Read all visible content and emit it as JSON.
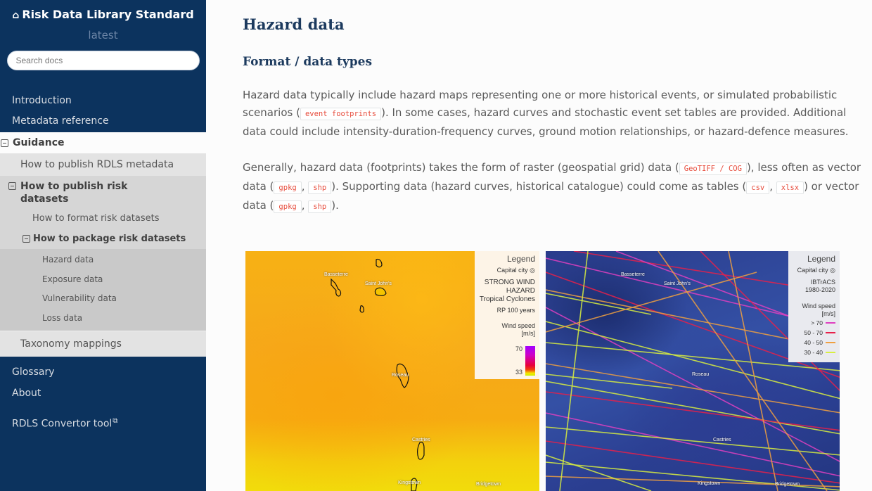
{
  "sidebar": {
    "brand": "Risk Data Library Standard",
    "home_icon": "home-icon",
    "version": "latest",
    "search_placeholder": "Search docs",
    "top_items": [
      "Introduction",
      "Metadata reference"
    ],
    "guidance": {
      "label": "Guidance",
      "children": {
        "publish_metadata": "How to publish RDLS metadata",
        "publish_risk": {
          "label": "How to publish risk datasets",
          "format": "How to format risk datasets",
          "package": {
            "label": "How to package risk datasets",
            "items": [
              "Hazard data",
              "Exposure data",
              "Vulnerability data",
              "Loss data"
            ]
          }
        },
        "taxonomy": "Taxonomy mappings"
      }
    },
    "bottom_items": [
      "Glossary",
      "About"
    ],
    "external": {
      "label": "RDLS Convertor tool",
      "icon": "external-link-icon"
    }
  },
  "main": {
    "title": "Hazard data",
    "subtitle": "Format / data types",
    "para1": {
      "t1": "Hazard data typically include hazard maps representing one or more historical events, or simulated probabilistic scenarios (",
      "c1": "event footprints",
      "t2": "). In some cases, hazard curves and stochastic event set tables are provided. Additional data could include intensity-duration-frequency curves, ground motion relationships, or hazard-defence measures."
    },
    "para2": {
      "t1": "Generally, hazard data (footprints) takes the form of raster (geospatial grid) data (",
      "c1": "GeoTIFF / COG",
      "t2": "), less often as vector data (",
      "c2": "gpkg",
      "t3": ", ",
      "c3": "shp",
      "t4": "). Supporting data (hazard curves, historical catalogue) could come as tables (",
      "c4": "csv",
      "t5": ", ",
      "c5": "xlsx",
      "t6": ") or vector data (",
      "c6": "gpkg",
      "t7": ", ",
      "c7": "shp",
      "t8": ")."
    }
  },
  "maps": {
    "left": {
      "legend_title": "Legend",
      "capital_city": "Capital city",
      "hazard_line1": "STRONG WIND",
      "hazard_line2": "HAZARD",
      "hazard_line3": "Tropical Cyclones",
      "rp": "RP 100 years",
      "var": "Wind speed",
      "unit": "[m/s]",
      "max": "70",
      "min": "33",
      "cities": [
        "Basseterre",
        "Saint John's",
        "Roseau",
        "Castries",
        "Kingstown",
        "Bridgetown"
      ]
    },
    "right": {
      "legend_title": "Legend",
      "capital_city": "Capital city",
      "source": "IBTrACS",
      "period": "1980-2020",
      "var": "Wind speed",
      "unit": "[m/s]",
      "classes": [
        {
          "label": "> 70",
          "color": "#e040c0"
        },
        {
          "label": "50 - 70",
          "color": "#e8204a"
        },
        {
          "label": "40 - 50",
          "color": "#f0a040"
        },
        {
          "label": "30 - 40",
          "color": "#d8ee40"
        }
      ],
      "cities": [
        "Basseterre",
        "Saint John's",
        "Roseau",
        "Castries",
        "Kingstown",
        "Bridgetown"
      ]
    }
  },
  "colors": {
    "sidebar_bg": "#0c335e",
    "heading": "#1c3a5e",
    "code": "#e74c3c"
  }
}
